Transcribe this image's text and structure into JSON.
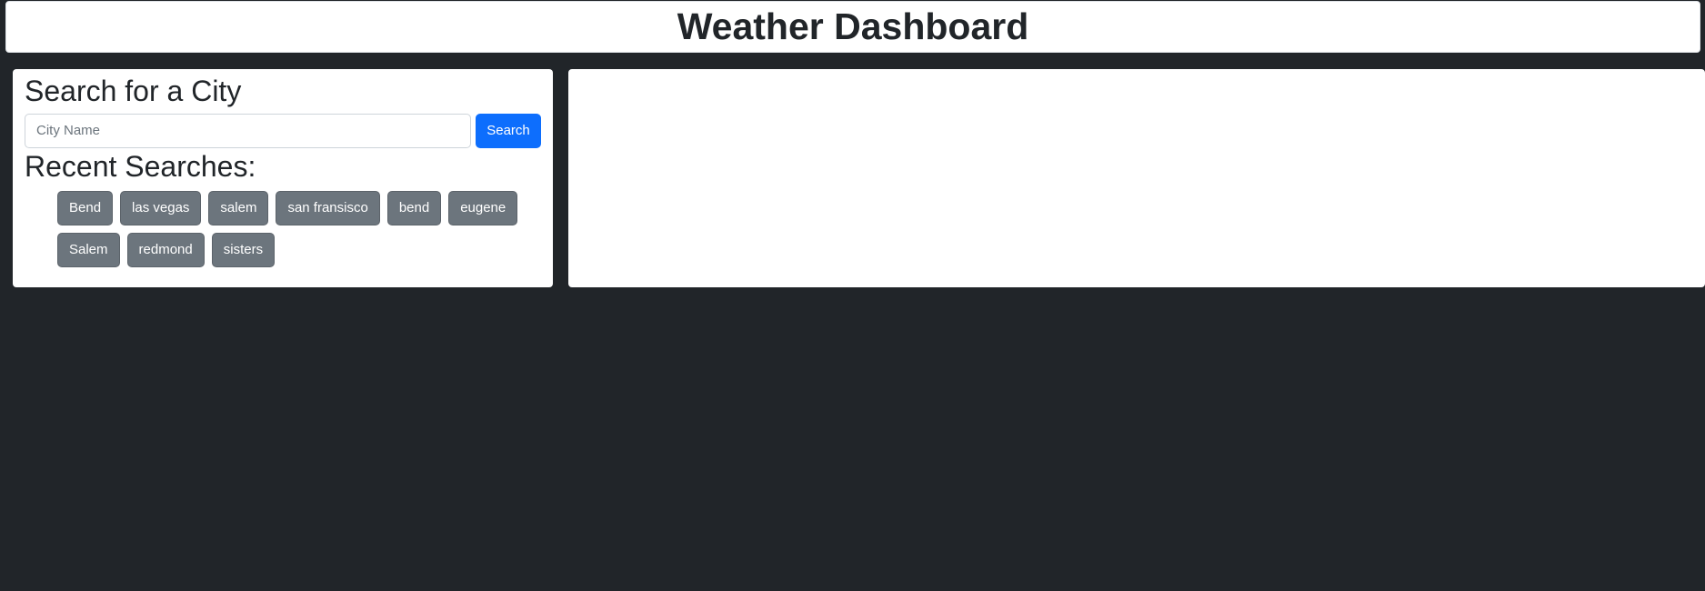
{
  "header": {
    "title": "Weather Dashboard"
  },
  "search": {
    "title": "Search for a City",
    "placeholder": "City Name",
    "value": "",
    "button_label": "Search"
  },
  "recent": {
    "title": "Recent Searches:",
    "items": [
      "Bend",
      "las vegas",
      "salem",
      "san fransisco",
      "bend",
      "eugene",
      "Salem",
      "redmond",
      "sisters"
    ]
  },
  "colors": {
    "background": "#212529",
    "primary": "#0d6efd",
    "secondary": "#6c757d"
  }
}
